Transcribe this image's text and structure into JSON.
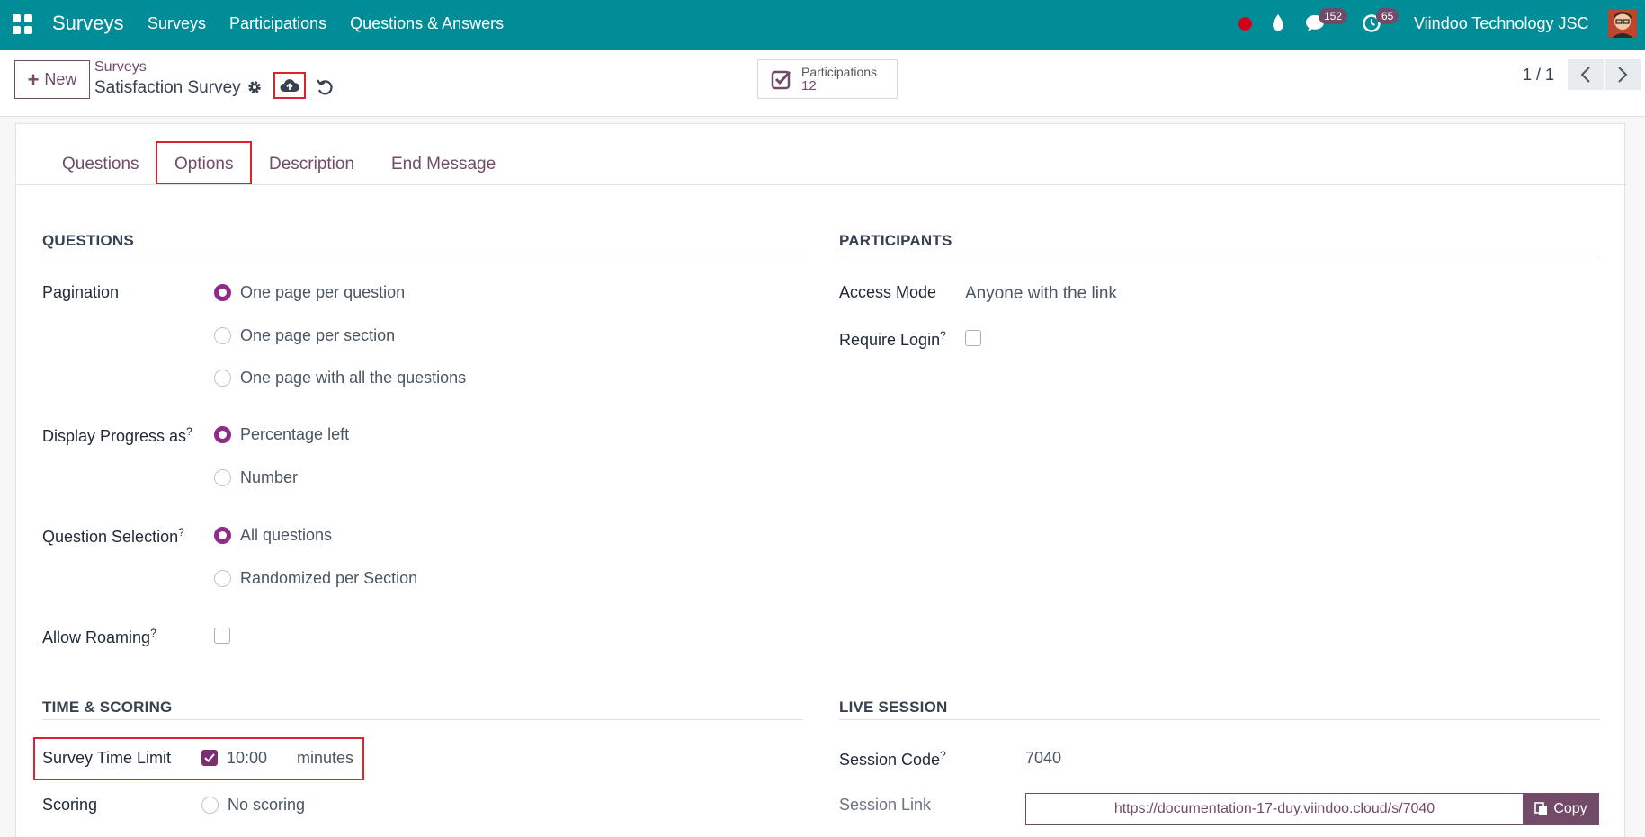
{
  "navbar": {
    "brand": "Surveys",
    "menu": [
      "Surveys",
      "Participations",
      "Questions & Answers"
    ],
    "chat_count": "152",
    "activity_count": "65",
    "company": "Viindoo Technology JSC"
  },
  "control": {
    "new_label": "New",
    "breadcrumb": "Surveys",
    "record_title": "Satisfaction Survey",
    "stat_label": "Participations",
    "stat_value": "12",
    "pager": "1 / 1"
  },
  "tabs": [
    "Questions",
    "Options",
    "Description",
    "End Message"
  ],
  "questions_section": {
    "title": "QUESTIONS",
    "pagination_label": "Pagination",
    "pagination_options": [
      "One page per question",
      "One page per section",
      "One page with all the questions"
    ],
    "pagination_selected": 0,
    "progress_label": "Display Progress as",
    "progress_options": [
      "Percentage left",
      "Number"
    ],
    "progress_selected": 0,
    "selection_label": "Question Selection",
    "selection_options": [
      "All questions",
      "Randomized per Section"
    ],
    "selection_selected": 0,
    "roaming_label": "Allow Roaming",
    "roaming_checked": false
  },
  "participants_section": {
    "title": "PARTICIPANTS",
    "access_label": "Access Mode",
    "access_value": "Anyone with the link",
    "login_label": "Require Login",
    "login_checked": false
  },
  "time_section": {
    "title": "TIME & SCORING",
    "time_limit_label": "Survey Time Limit",
    "time_limit_checked": true,
    "time_limit_value": "10:00",
    "time_unit": "minutes",
    "scoring_label": "Scoring",
    "scoring_option": "No scoring"
  },
  "live_section": {
    "title": "LIVE SESSION",
    "code_label": "Session Code",
    "code_value": "7040",
    "link_label": "Session Link",
    "link_value": "https://documentation-17-duy.viindoo.cloud/s/7040",
    "copy_label": "Copy"
  },
  "tooltip_marker": "?",
  "colors": {
    "navbar": "#018d98",
    "brand_purple": "#714b67",
    "highlight_red": "#d9232e"
  }
}
